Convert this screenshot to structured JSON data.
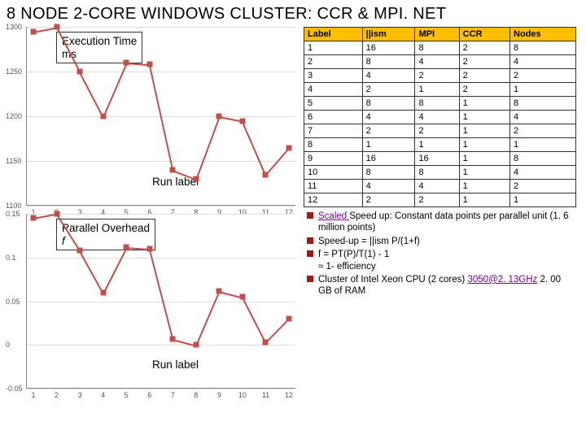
{
  "title": "8 NODE 2-CORE WINDOWS CLUSTER: CCR & MPI. NET",
  "chart1": {
    "overlay_line1": "Execution Time",
    "overlay_line2": "ms",
    "runlabel": "Run label"
  },
  "chart2": {
    "overlay_line1": "Parallel Overhead",
    "overlay_line2": "f",
    "runlabel": "Run label"
  },
  "table": {
    "headers": [
      "Label",
      "||ism",
      "MPI",
      "CCR",
      "Nodes"
    ],
    "rows": [
      [
        "1",
        "16",
        "8",
        "2",
        "8"
      ],
      [
        "2",
        "8",
        "4",
        "2",
        "4"
      ],
      [
        "3",
        "4",
        "2",
        "2",
        "2"
      ],
      [
        "4",
        "2",
        "1",
        "2",
        "1"
      ],
      [
        "5",
        "8",
        "8",
        "1",
        "8"
      ],
      [
        "6",
        "4",
        "4",
        "1",
        "4"
      ],
      [
        "7",
        "2",
        "2",
        "1",
        "2"
      ],
      [
        "8",
        "1",
        "1",
        "1",
        "1"
      ],
      [
        "9",
        "16",
        "16",
        "1",
        "8"
      ],
      [
        "10",
        "8",
        "8",
        "1",
        "4"
      ],
      [
        "11",
        "4",
        "4",
        "1",
        "2"
      ],
      [
        "12",
        "2",
        "2",
        "1",
        "1"
      ]
    ]
  },
  "bullets": {
    "b1a": "Scaled ",
    "b1b": "Speed up: Constant data points per parallel unit (1. 6 million points)",
    "b2": "Speed-up = ||ism P/(1+f)",
    "b3a": "f = PT(P)/T(1)  - 1",
    "b3b": "≈ 1- efficiency",
    "b4a": "Cluster of Intel Xeon CPU (2 cores) ",
    "b4b": "3050@2. 13GHz",
    "b4c": " 2. 00 GB of RAM"
  },
  "chart_data": [
    {
      "type": "line",
      "title": "Execution Time ms",
      "xlabel": "Run label",
      "ylabel": "ms",
      "x": [
        1,
        2,
        3,
        4,
        5,
        6,
        7,
        8,
        9,
        10,
        11,
        12
      ],
      "values": [
        1295,
        1300,
        1250,
        1200,
        1260,
        1258,
        1140,
        1130,
        1200,
        1195,
        1135,
        1165
      ],
      "ylim": [
        1100,
        1300
      ],
      "yticks": [
        1100,
        1150,
        1200,
        1250,
        1300
      ]
    },
    {
      "type": "line",
      "title": "Parallel Overhead f",
      "xlabel": "Run label",
      "ylabel": "f",
      "x": [
        1,
        2,
        3,
        4,
        5,
        6,
        7,
        8,
        9,
        10,
        11,
        12
      ],
      "values": [
        0.145,
        0.15,
        0.108,
        0.06,
        0.112,
        0.11,
        0.007,
        0,
        0.062,
        0.055,
        0.003,
        0.03
      ],
      "ylim": [
        -0.05,
        0.15
      ],
      "yticks": [
        -0.05,
        0,
        0.05,
        0.1,
        0.15
      ]
    }
  ]
}
